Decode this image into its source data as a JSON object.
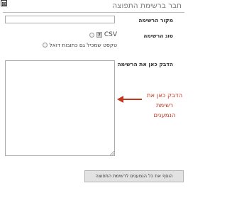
{
  "dialog": {
    "title": "חבר ברשימת התפוצה",
    "close_symbol": "⊠"
  },
  "form": {
    "source_label": "מקור הרשימה",
    "source_value": "",
    "type_label": "סוג הרשימה",
    "type_options": [
      {
        "label": "CSV",
        "help_symbol": "?",
        "selected": false
      },
      {
        "label": "טקסט שמכיל גם כתובות דואל",
        "selected": false
      }
    ],
    "paste_label": "הדבק כאן את הרשימה",
    "paste_value": ""
  },
  "hint": {
    "text": "הדבק כאן את רשימת הנמענים",
    "color": "#c43520"
  },
  "submit_label": "הוסף את כל הנמענים לרשימת התפוצה"
}
